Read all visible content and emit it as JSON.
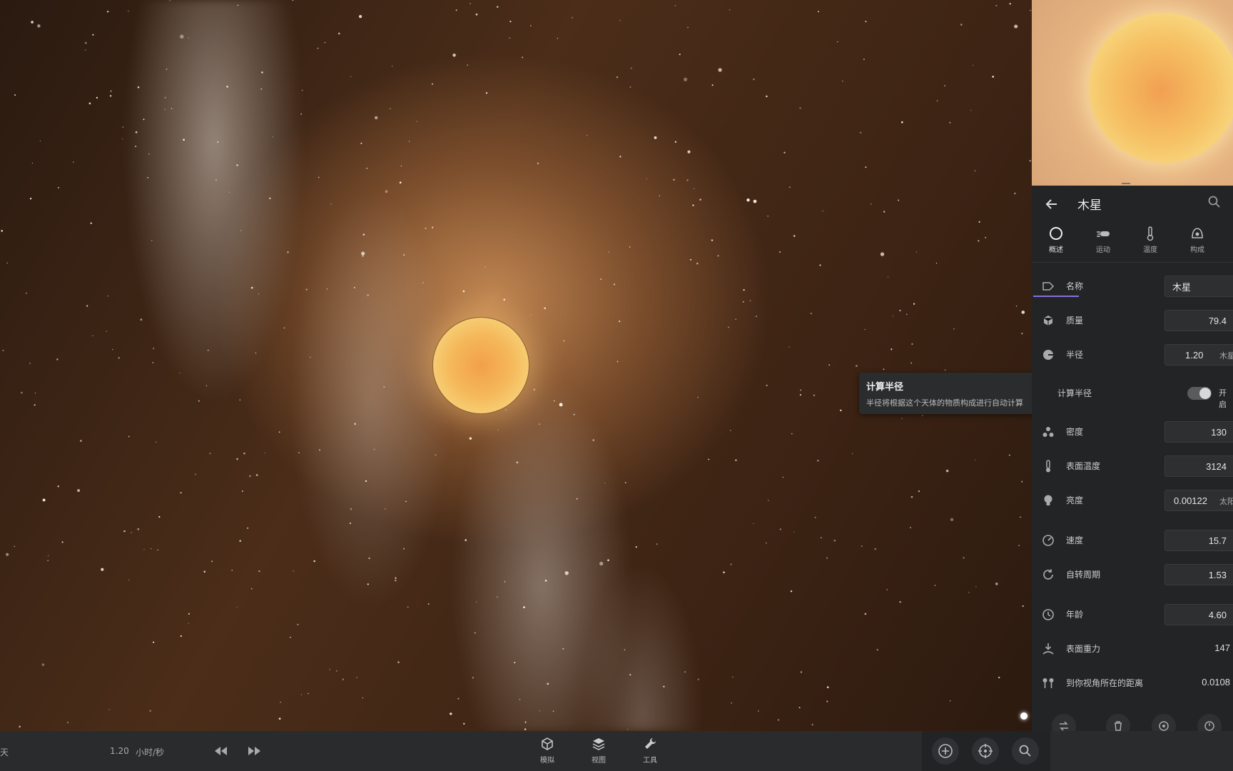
{
  "object": {
    "name": "木星"
  },
  "tabs": [
    {
      "label": "概述",
      "icon": "circle-icon",
      "active": true
    },
    {
      "label": "运动",
      "icon": "motion-icon",
      "active": false
    },
    {
      "label": "温度",
      "icon": "thermometer-icon",
      "active": false
    },
    {
      "label": "构成",
      "icon": "composition-icon",
      "active": false
    }
  ],
  "properties": {
    "name": {
      "label": "名称",
      "value": "木星"
    },
    "mass": {
      "label": "质量",
      "value": "79.4"
    },
    "radius": {
      "label": "半径",
      "value": "1.20",
      "unit": "木星"
    },
    "calc_radius": {
      "label": "计算半径",
      "toggle_label": "开启",
      "on": true
    },
    "density": {
      "label": "密度",
      "value": "130"
    },
    "surface_temp": {
      "label": "表面温度",
      "value": "3124"
    },
    "luminosity": {
      "label": "亮度",
      "value": "0.00122",
      "unit": "太阳"
    },
    "speed": {
      "label": "速度",
      "value": "15.7"
    },
    "rotation": {
      "label": "自转周期",
      "value": "1.53"
    },
    "age": {
      "label": "年龄",
      "value": "4.60"
    },
    "gravity": {
      "label": "表面重力",
      "value": "147"
    },
    "distance": {
      "label": "到你视角所在的距离",
      "value": "0.0108"
    }
  },
  "tooltip": {
    "title": "计算半径",
    "description": "半径将根据这个天体的物质构成进行自动计算"
  },
  "bottombar": {
    "time_unit_fragment": "天",
    "speed_value": "1.20",
    "speed_unit": "小时/秒",
    "tools": [
      {
        "label": "模拟",
        "icon": "cube-icon"
      },
      {
        "label": "视图",
        "icon": "layers-icon"
      },
      {
        "label": "工具",
        "icon": "wrench-icon"
      }
    ]
  },
  "colors": {
    "panel_bg": "#232426",
    "accent": "#8a6fd8",
    "bar_bg": "#2a2b2d"
  }
}
